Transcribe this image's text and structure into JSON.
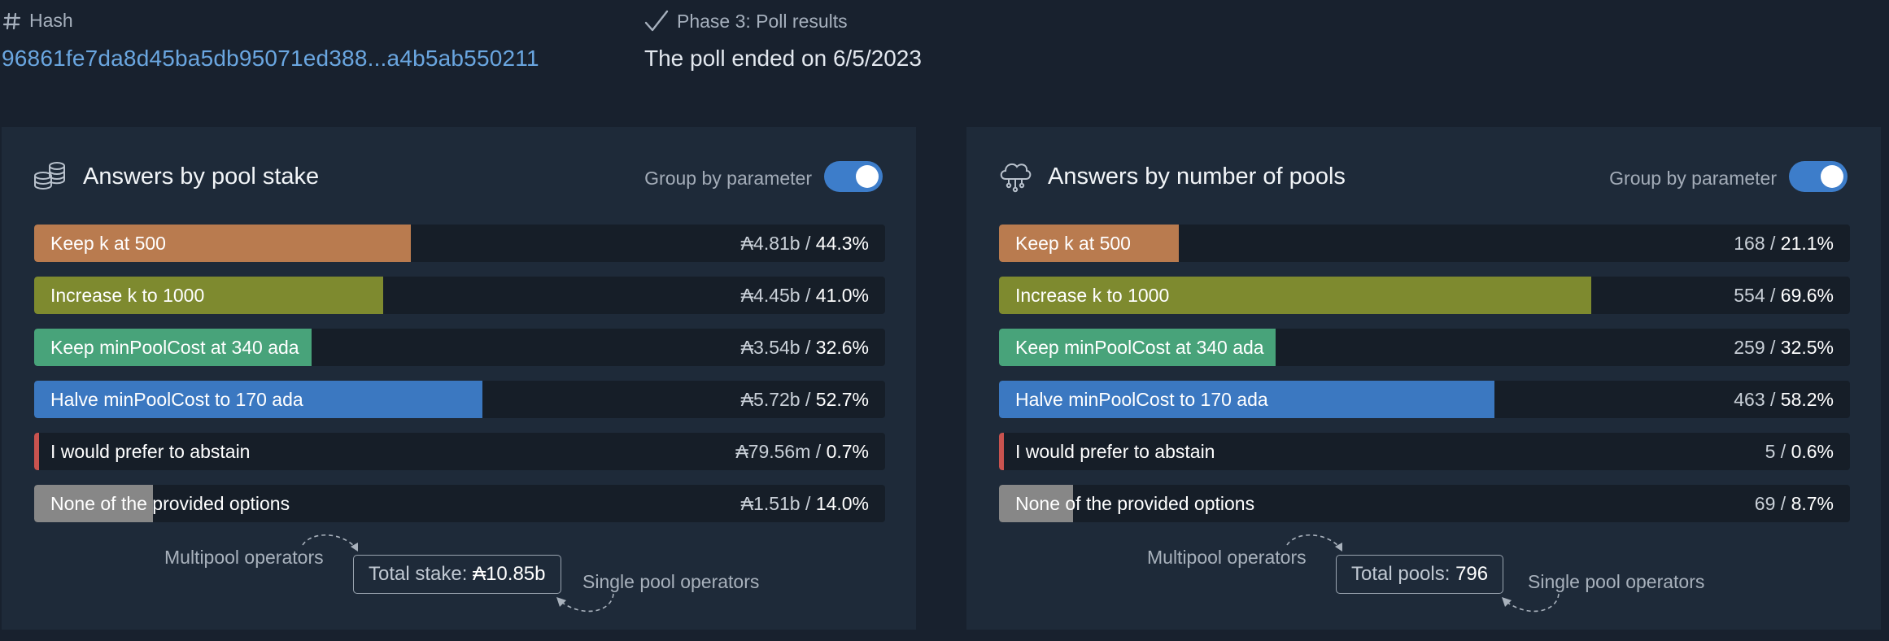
{
  "header": {
    "hash_label": "Hash",
    "hash_value": "96861fe7da8d45ba5db95071ed388...a4b5ab550211",
    "phase_label": "Phase 3: Poll results",
    "poll_ended": "The poll ended on 6/5/2023"
  },
  "left_panel": {
    "title": "Answers by pool stake",
    "icon": "coins-icon",
    "group_label": "Group by parameter",
    "group_toggle_on": true,
    "rows": [
      {
        "label": "Keep k at 500",
        "amount": "₳4.81b",
        "percent": "44.3%",
        "fraction": 0.443,
        "color": "#b97b4f"
      },
      {
        "label": "Increase k to 1000",
        "amount": "₳4.45b",
        "percent": "41.0%",
        "fraction": 0.41,
        "color": "#7e8a2f"
      },
      {
        "label": "Keep minPoolCost at 340 ada",
        "amount": "₳3.54b",
        "percent": "32.6%",
        "fraction": 0.326,
        "color": "#48a37a"
      },
      {
        "label": "Halve minPoolCost to 170 ada",
        "amount": "₳5.72b",
        "percent": "52.7%",
        "fraction": 0.527,
        "color": "#3b78c1"
      },
      {
        "label": "I would prefer to abstain",
        "amount": "₳79.56m",
        "percent": "0.7%",
        "fraction": 0.007,
        "color": "#c9534f"
      },
      {
        "label": "None of the provided options",
        "amount": "₳1.51b",
        "percent": "14.0%",
        "fraction": 0.14,
        "color": "#878787"
      }
    ],
    "multipool_label": "Multipool operators",
    "single_label": "Single pool operators",
    "total_label": "Total stake:",
    "total_value": "₳10.85b"
  },
  "right_panel": {
    "title": "Answers by number of pools",
    "icon": "cloud-network-icon",
    "group_label": "Group by parameter",
    "group_toggle_on": true,
    "rows": [
      {
        "label": "Keep k at 500",
        "amount": "168",
        "percent": "21.1%",
        "fraction": 0.211,
        "color": "#b97b4f"
      },
      {
        "label": "Increase k to 1000",
        "amount": "554",
        "percent": "69.6%",
        "fraction": 0.696,
        "color": "#7e8a2f"
      },
      {
        "label": "Keep minPoolCost at 340 ada",
        "amount": "259",
        "percent": "32.5%",
        "fraction": 0.325,
        "color": "#48a37a"
      },
      {
        "label": "Halve minPoolCost to 170 ada",
        "amount": "463",
        "percent": "58.2%",
        "fraction": 0.582,
        "color": "#3b78c1"
      },
      {
        "label": "I would prefer to abstain",
        "amount": "5",
        "percent": "0.6%",
        "fraction": 0.006,
        "color": "#c9534f"
      },
      {
        "label": "None of the provided options",
        "amount": "69",
        "percent": "8.7%",
        "fraction": 0.087,
        "color": "#878787"
      }
    ],
    "multipool_label": "Multipool operators",
    "single_label": "Single pool operators",
    "total_label": "Total pools:",
    "total_value": "796"
  }
}
